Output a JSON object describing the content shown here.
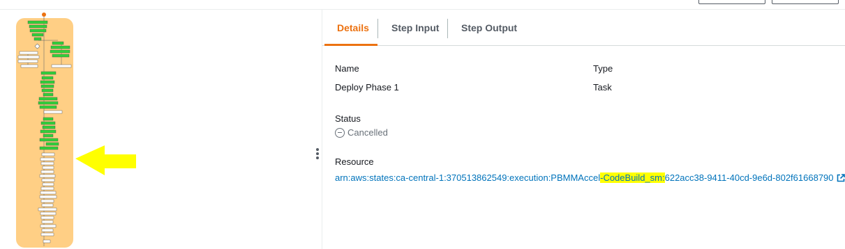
{
  "tabs": [
    {
      "label": "Details",
      "active": true
    },
    {
      "label": "Step Input",
      "active": false
    },
    {
      "label": "Step Output",
      "active": false
    }
  ],
  "details": {
    "name_label": "Name",
    "name_value": "Deploy Phase 1",
    "type_label": "Type",
    "type_value": "Task",
    "status_label": "Status",
    "status_value": "Cancelled",
    "resource_label": "Resource",
    "resource_prefix": "arn:aws:states:ca-central-1:370513862549:execution:PBMMAccel",
    "resource_highlight_1": "-CodeBuild_sm:",
    "resource_suffix": "622acc38-9411-40cd-9e6d-802f61668790"
  },
  "graph": {
    "state_colors": {
      "succeeded": "#31d03a",
      "not_run": "#ffffff",
      "background": "#ffcf85"
    },
    "annotation_color": "#ffff00"
  },
  "colors": {
    "accent": "#ec7211",
    "link": "#0073bb",
    "muted": "#687078"
  }
}
